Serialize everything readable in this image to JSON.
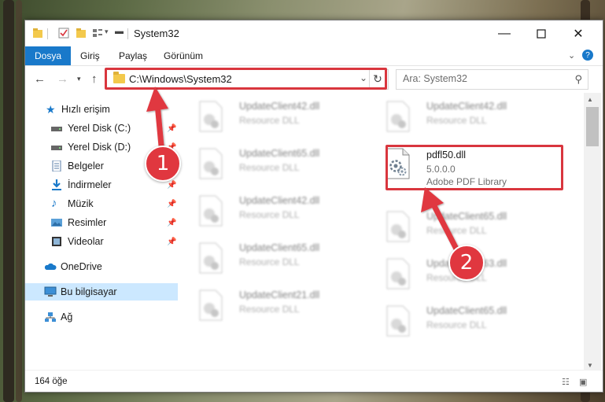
{
  "window": {
    "title": "System32"
  },
  "ribbon": {
    "tabs": [
      "Dosya",
      "Giriş",
      "Paylaş",
      "Görünüm"
    ]
  },
  "address": {
    "path": "C:\\Windows\\System32"
  },
  "search": {
    "placeholder": "Ara: System32"
  },
  "sidebar": {
    "items": [
      {
        "label": "Hızlı erişim",
        "icon": "star-icon",
        "pinned": false
      },
      {
        "label": "Yerel Disk (C:)",
        "icon": "drive-icon",
        "pinned": true
      },
      {
        "label": "Yerel Disk (D:)",
        "icon": "drive-icon",
        "pinned": true
      },
      {
        "label": "Belgeler",
        "icon": "document-icon",
        "pinned": true
      },
      {
        "label": "İndirmeler",
        "icon": "download-icon",
        "pinned": true
      },
      {
        "label": "Müzik",
        "icon": "music-icon",
        "pinned": true
      },
      {
        "label": "Resimler",
        "icon": "pictures-icon",
        "pinned": true
      },
      {
        "label": "Videolar",
        "icon": "video-icon",
        "pinned": true
      },
      {
        "label": "OneDrive",
        "icon": "cloud-icon",
        "pinned": false
      },
      {
        "label": "Bu bilgisayar",
        "icon": "computer-icon",
        "pinned": false,
        "selected": true
      },
      {
        "label": "Ağ",
        "icon": "network-icon",
        "pinned": false
      }
    ]
  },
  "files": {
    "left": [
      {
        "name": "UpdateClient42.dll",
        "sub": "Resource DLL"
      },
      {
        "name": "UpdateClient65.dll",
        "sub": "Resource DLL"
      },
      {
        "name": "UpdateClient42.dll",
        "sub": "Resource DLL"
      },
      {
        "name": "UpdateClient65.dll",
        "sub": "Resource DLL"
      },
      {
        "name": "UpdateClient21.dll",
        "sub": "Resource DLL"
      }
    ],
    "right": [
      {
        "name": "UpdateClient42.dll",
        "sub": "Resource DLL"
      },
      {
        "name": "pdfl50.dll",
        "version": "5.0.0.0",
        "description": "Adobe PDF Library"
      },
      {
        "name": "UpdateClient65.dll",
        "sub": "Resource DLL"
      },
      {
        "name": "UpdateClient63.dll",
        "sub": "Resource DLL"
      },
      {
        "name": "UpdateClient65.dll",
        "sub": "Resource DLL"
      }
    ]
  },
  "status": {
    "count": "164 öğe"
  },
  "callouts": [
    "1",
    "2"
  ],
  "colors": {
    "accent": "#1979ca",
    "highlight": "#d9363e",
    "selection": "#cce8ff"
  }
}
